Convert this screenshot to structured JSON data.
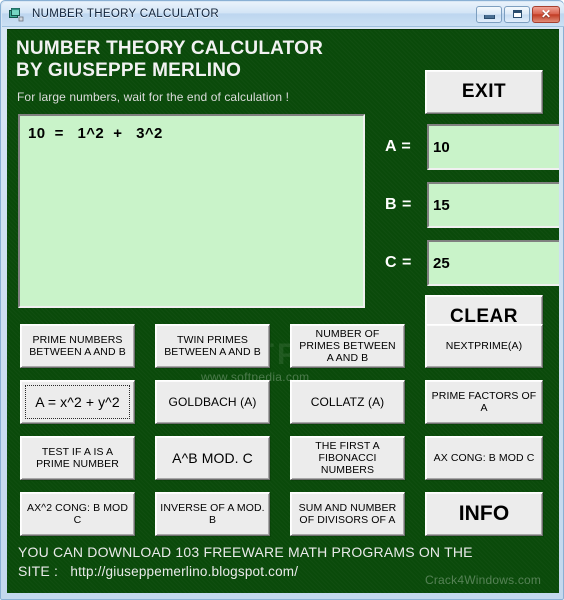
{
  "window": {
    "title": "NUMBER THEORY CALCULATOR",
    "icon": "vb-form-icon",
    "controls": {
      "minimize": "minimize-icon",
      "maximize": "maximize-icon",
      "close": "✕"
    }
  },
  "header": {
    "title_line1": "NUMBER THEORY CALCULATOR",
    "title_line2": "BY GIUSEPPE MERLINO",
    "hint": "For large numbers, wait for the end of calculation !"
  },
  "output": {
    "text": "10  =   1^2  +   3^2"
  },
  "fields": {
    "a": {
      "label": "A =",
      "value": "10"
    },
    "b": {
      "label": "B =",
      "value": "15"
    },
    "c": {
      "label": "C =",
      "value": "25"
    }
  },
  "actions": {
    "exit": "EXIT",
    "clear": "CLEAR"
  },
  "buttons": [
    {
      "label": "PRIME NUMBERS\nBETWEEN A AND B",
      "name": "prime-numbers-between-a-and-b-button",
      "focused": false,
      "size": "sm"
    },
    {
      "label": "TWIN PRIMES\nBETWEEN A AND B",
      "name": "twin-primes-between-a-and-b-button",
      "focused": false,
      "size": "sm"
    },
    {
      "label": "NUMBER OF\nPRIMES BETWEEN\nA AND B",
      "name": "number-of-primes-between-a-and-b-button",
      "focused": false,
      "size": "sm"
    },
    {
      "label": "NEXTPRIME(A)",
      "name": "nextprime-a-button",
      "focused": false,
      "size": "sm"
    },
    {
      "label": "A = x^2 + y^2",
      "name": "sum-of-two-squares-button",
      "focused": true,
      "size": "big"
    },
    {
      "label": "GOLDBACH (A)",
      "name": "goldbach-a-button",
      "focused": false,
      "size": "md"
    },
    {
      "label": "COLLATZ (A)",
      "name": "collatz-a-button",
      "focused": false,
      "size": "md"
    },
    {
      "label": "PRIME FACTORS OF\nA",
      "name": "prime-factors-of-a-button",
      "focused": false,
      "size": "sm"
    },
    {
      "label": "TEST IF A IS A\nPRIME NUMBER",
      "name": "test-if-a-is-a-prime-number-button",
      "focused": false,
      "size": "sm"
    },
    {
      "label": "A^B MOD. C",
      "name": "a-pow-b-mod-c-button",
      "focused": false,
      "size": "big"
    },
    {
      "label": "THE FIRST A\nFIBONACCI\nNUMBERS",
      "name": "first-a-fibonacci-numbers-button",
      "focused": false,
      "size": "sm"
    },
    {
      "label": "AX CONG: B MOD C",
      "name": "ax-cong-b-mod-c-button",
      "focused": false,
      "size": "sm"
    },
    {
      "label": "AX^2 CONG: B MOD\nC",
      "name": "ax2-cong-b-mod-c-button",
      "focused": false,
      "size": "sm"
    },
    {
      "label": "INVERSE OF A MOD.\nB",
      "name": "inverse-of-a-mod-b-button",
      "focused": false,
      "size": "sm"
    },
    {
      "label": "SUM AND NUMBER\nOF DIVISORS OF A",
      "name": "sum-and-number-of-divisors-of-a-button",
      "focused": false,
      "size": "sm"
    },
    {
      "label": "INFO",
      "name": "info-button",
      "focused": false,
      "size": "xl"
    }
  ],
  "footer": {
    "line1": "YOU CAN DOWNLOAD 103 FREEWARE MATH PROGRAMS ON THE",
    "line2_prefix": "SITE :   ",
    "url": "http://giuseppemerlino.blogspot.com/"
  },
  "watermarks": {
    "softpedia_big": "SOFTPEDIA",
    "softpedia_small": "www.softpedia.com",
    "crack4windows": "Crack4Windows.com"
  },
  "colors": {
    "form_background": "#0a4a0a",
    "textbox_background": "#c9f3c9",
    "button_face": "#ececec",
    "titlebar": "#cfe3f5"
  }
}
